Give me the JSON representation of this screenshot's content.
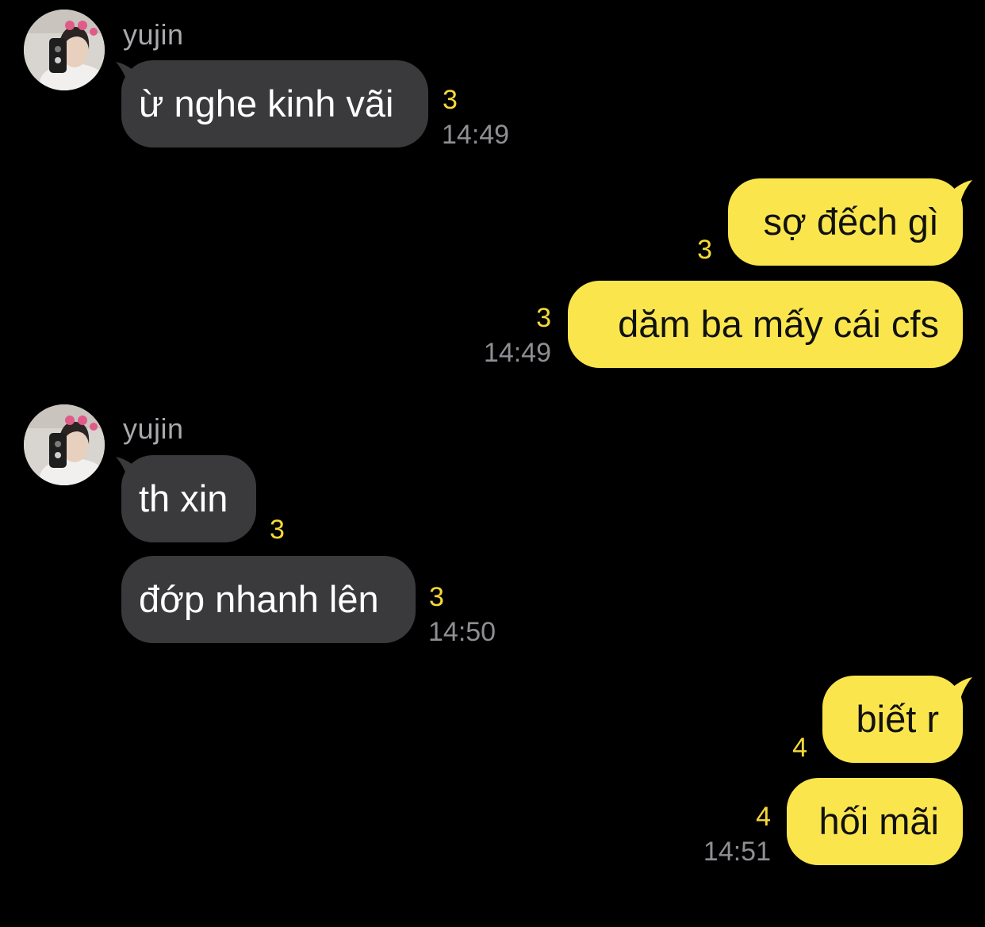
{
  "contact": {
    "name": "yujin"
  },
  "colors": {
    "background": "#000000",
    "incoming_bubble": "#3a3a3c",
    "outgoing_bubble": "#fae64c",
    "unread_count": "#f5d93a",
    "timestamp": "#8e8e93"
  },
  "groups": [
    {
      "sender": "yujin",
      "direction": "incoming",
      "messages": [
        {
          "text": "ừ nghe kinh vãi",
          "unread": "3",
          "time": "14:49"
        }
      ]
    },
    {
      "sender": "me",
      "direction": "outgoing",
      "messages": [
        {
          "text": "sợ đếch gì",
          "unread": "3",
          "time": ""
        },
        {
          "text": "dăm ba mấy cái cfs",
          "unread": "3",
          "time": "14:49"
        }
      ]
    },
    {
      "sender": "yujin",
      "direction": "incoming",
      "messages": [
        {
          "text": "th xin",
          "unread": "3",
          "time": ""
        },
        {
          "text": "đớp nhanh lên",
          "unread": "3",
          "time": "14:50"
        }
      ]
    },
    {
      "sender": "me",
      "direction": "outgoing",
      "messages": [
        {
          "text": "biết r",
          "unread": "4",
          "time": ""
        },
        {
          "text": "hối mãi",
          "unread": "4",
          "time": "14:51"
        }
      ]
    }
  ]
}
